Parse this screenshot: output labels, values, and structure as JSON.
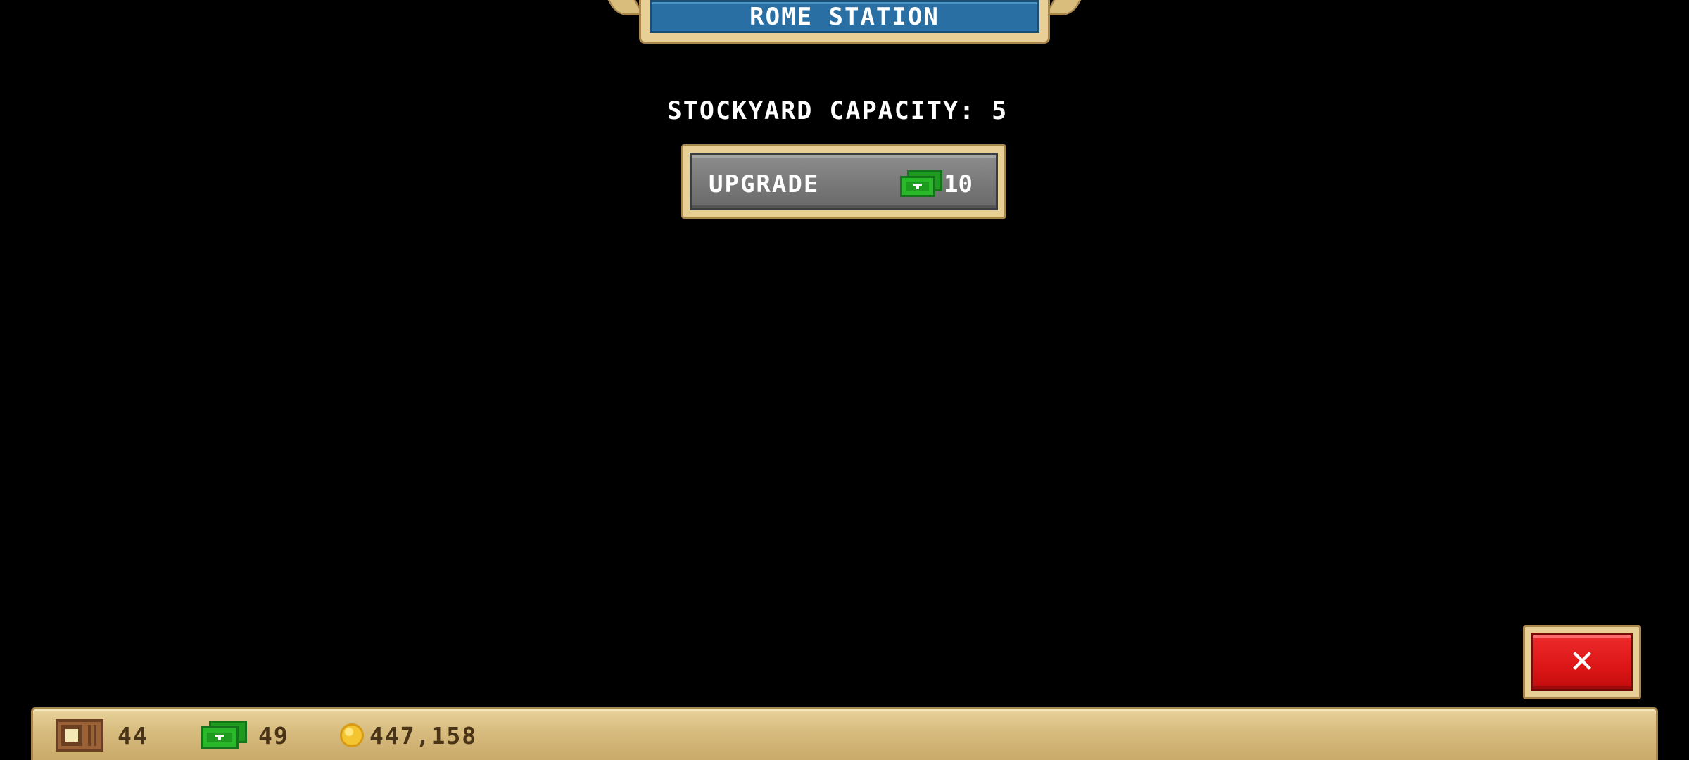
{
  "header": {
    "station_name": "ROME STATION"
  },
  "stockyard": {
    "capacity_text": "STOCKYARD CAPACITY: 5"
  },
  "upgrade": {
    "label": "UPGRADE",
    "cost": "10",
    "currency_icon": "cash-icon"
  },
  "close": {
    "glyph": "✕"
  },
  "resources": {
    "crates": "44",
    "cash": "49",
    "coins": "447,158"
  },
  "colors": {
    "title_blue": "#2a6fa3",
    "frame_tan": "#e7cf95",
    "button_gray": "#7a7a7a",
    "close_red": "#dc1616",
    "cash_green": "#1e9a1e"
  }
}
